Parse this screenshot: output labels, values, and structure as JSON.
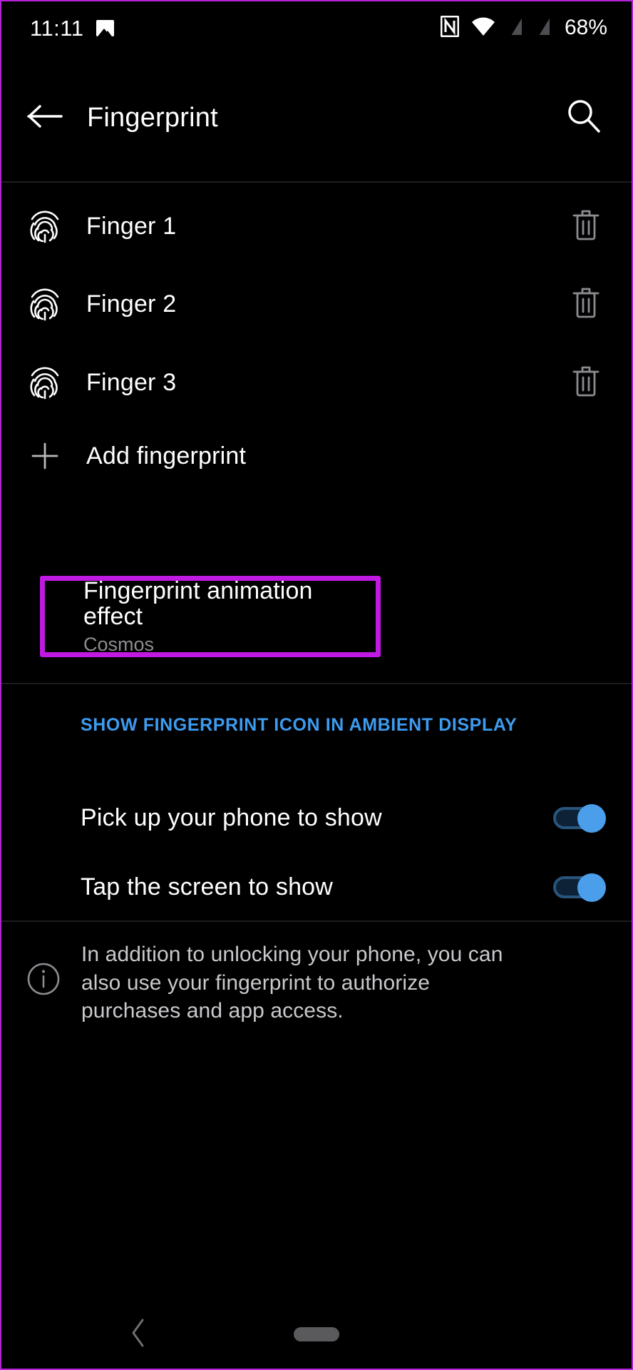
{
  "status_bar": {
    "time": "11:11",
    "battery_percent": "68%",
    "icons": [
      "photo-icon",
      "nfc-icon",
      "wifi-icon",
      "signal-no-sim-icon",
      "signal-no-sim-2-icon"
    ]
  },
  "header": {
    "title": "Fingerprint",
    "back_icon": "arrow-left-icon",
    "search_icon": "search-icon"
  },
  "fingerprints": [
    {
      "label": "Finger 1",
      "icon": "fingerprint-icon",
      "delete_icon": "trash-icon"
    },
    {
      "label": "Finger 2",
      "icon": "fingerprint-icon",
      "delete_icon": "trash-icon"
    },
    {
      "label": "Finger 3",
      "icon": "fingerprint-icon",
      "delete_icon": "trash-icon"
    }
  ],
  "add_fingerprint": {
    "label": "Add fingerprint",
    "icon": "plus-icon"
  },
  "animation_effect": {
    "title": "Fingerprint animation effect",
    "value": "Cosmos",
    "highlight_color": "#c01ae2"
  },
  "ambient_section": {
    "header": "SHOW FINGERPRINT ICON IN AMBIENT DISPLAY",
    "header_color": "#3d9bf0",
    "toggles": [
      {
        "label": "Pick up your phone to show",
        "state": "on"
      },
      {
        "label": "Tap the screen to show",
        "state": "on"
      }
    ],
    "accent_color": "#4a9eea"
  },
  "info": {
    "icon": "info-circle-icon",
    "text": "In addition to unlocking your phone, you can also use your fingerprint to authorize purchases and app access."
  },
  "navbar": {
    "back_icon": "chevron-left-icon",
    "home_pill": "home-pill-icon"
  }
}
